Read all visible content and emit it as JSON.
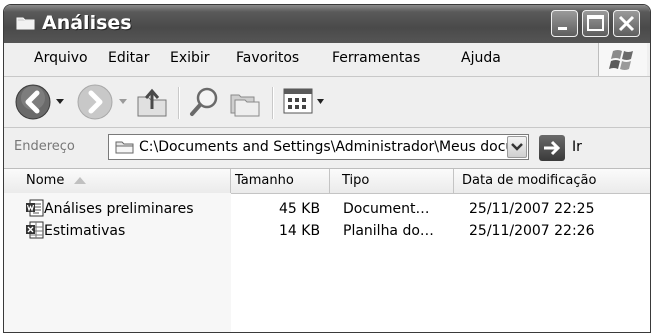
{
  "window": {
    "title": "Análises"
  },
  "menu": {
    "items": [
      {
        "label": "Arquivo"
      },
      {
        "label": "Editar"
      },
      {
        "label": "Exibir"
      },
      {
        "label": "Favoritos"
      },
      {
        "label": "Ferramentas"
      },
      {
        "label": "Ajuda"
      }
    ]
  },
  "toolbar": {
    "icons": [
      "back-arrow-icon",
      "forward-arrow-icon",
      "up-folder-icon",
      "search-icon",
      "folders-icon",
      "views-icon"
    ]
  },
  "address": {
    "label": "Endereço",
    "value": "C:\\Documents and Settings\\Administrador\\Meus documentos\\Análises",
    "go_label": "Ir"
  },
  "columns": [
    {
      "label": "Nome"
    },
    {
      "label": "Tamanho"
    },
    {
      "label": "Tipo"
    },
    {
      "label": "Data de modificação"
    }
  ],
  "files": [
    {
      "name": "Análises preliminares",
      "size": "45 KB",
      "type": "Document…",
      "modified": "25/11/2007 22:25",
      "icon": "word-document-icon"
    },
    {
      "name": "Estimativas",
      "size": "14 KB",
      "type": "Planilha do…",
      "modified": "25/11/2007 22:26",
      "icon": "excel-spreadsheet-icon"
    }
  ]
}
